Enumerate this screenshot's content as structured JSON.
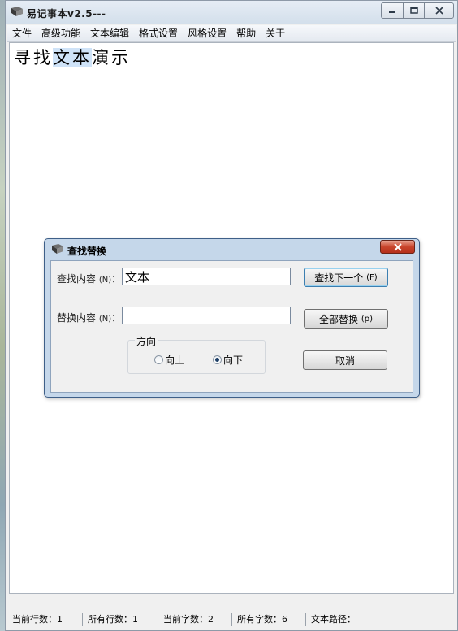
{
  "window": {
    "title": "易记事本v2.5---"
  },
  "menu": {
    "items": [
      "文件",
      "高级功能",
      "文本编辑",
      "格式设置",
      "风格设置",
      "帮助",
      "关于"
    ]
  },
  "document": {
    "before": "寻找",
    "selected": "文本",
    "after": "演示"
  },
  "status": {
    "current_line": "当前行数：1",
    "total_lines": "所有行数：1",
    "current_chars": "当前字数：2",
    "total_chars": "所有字数：6",
    "path": "文本路径："
  },
  "dialog": {
    "title": "查找替换",
    "find_label": "查找内容",
    "find_hotkey": "(N)",
    "find_value": "文本",
    "replace_label": "替换内容",
    "replace_hotkey": "(N)",
    "replace_value": "",
    "find_next_label": "查找下一个",
    "find_next_hotkey": "(F)",
    "replace_all_label": "全部替换",
    "replace_all_hotkey": "(p)",
    "cancel_label": "取消",
    "direction_label": "方向",
    "up_label": "向上",
    "down_label": "向下",
    "selected_direction": "down"
  },
  "colors": {
    "selection": "#cfe3f8",
    "dialog_frame": "#c5d7ea",
    "close_button": "#c9452c"
  }
}
